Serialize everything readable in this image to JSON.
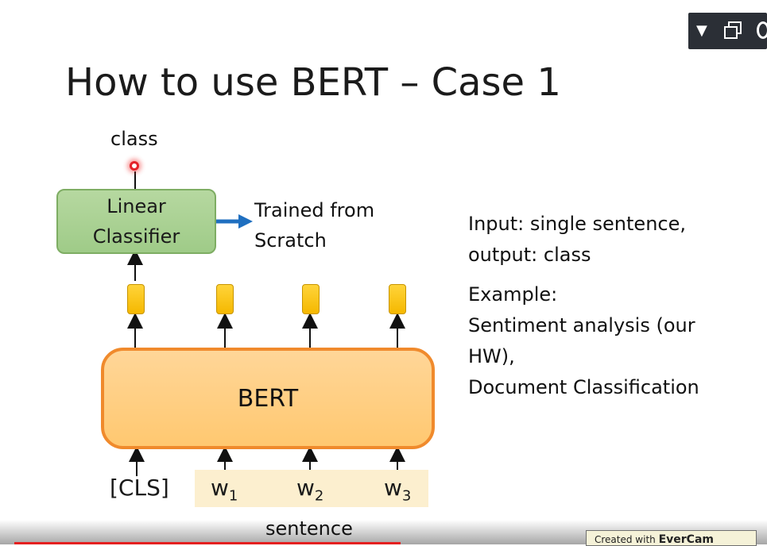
{
  "slide": {
    "title": "How to use BERT – Case 1"
  },
  "diagram": {
    "output_label": "class",
    "classifier_line1": "Linear",
    "classifier_line2": "Classifier",
    "trained_line1": "Trained from",
    "trained_line2": "Scratch",
    "model_label": "BERT",
    "inputs": [
      {
        "text": "[CLS]",
        "sub": ""
      },
      {
        "text": "w",
        "sub": "1"
      },
      {
        "text": "w",
        "sub": "2"
      },
      {
        "text": "w",
        "sub": "3"
      }
    ],
    "sentence_label": "sentence"
  },
  "notes": {
    "line1": "Input: single sentence,",
    "line2": "output: class",
    "line3": "Example:",
    "line4": "Sentiment analysis (our",
    "line5": "HW),",
    "line6": "Document Classification"
  },
  "watermark": {
    "prefix": "Created with ",
    "brand": "EverCam"
  },
  "player": {
    "dropdown_icon": "triangle-down-icon",
    "restore_icon": "window-restore-icon"
  },
  "colors": {
    "classifier_fill": "#9fcb88",
    "bert_border": "#f08a2c",
    "bert_fill": "#ffc870",
    "token_fill": "#f5b800",
    "arrow_blue": "#1f6fc0",
    "sentence_highlight": "#fcefcf"
  }
}
